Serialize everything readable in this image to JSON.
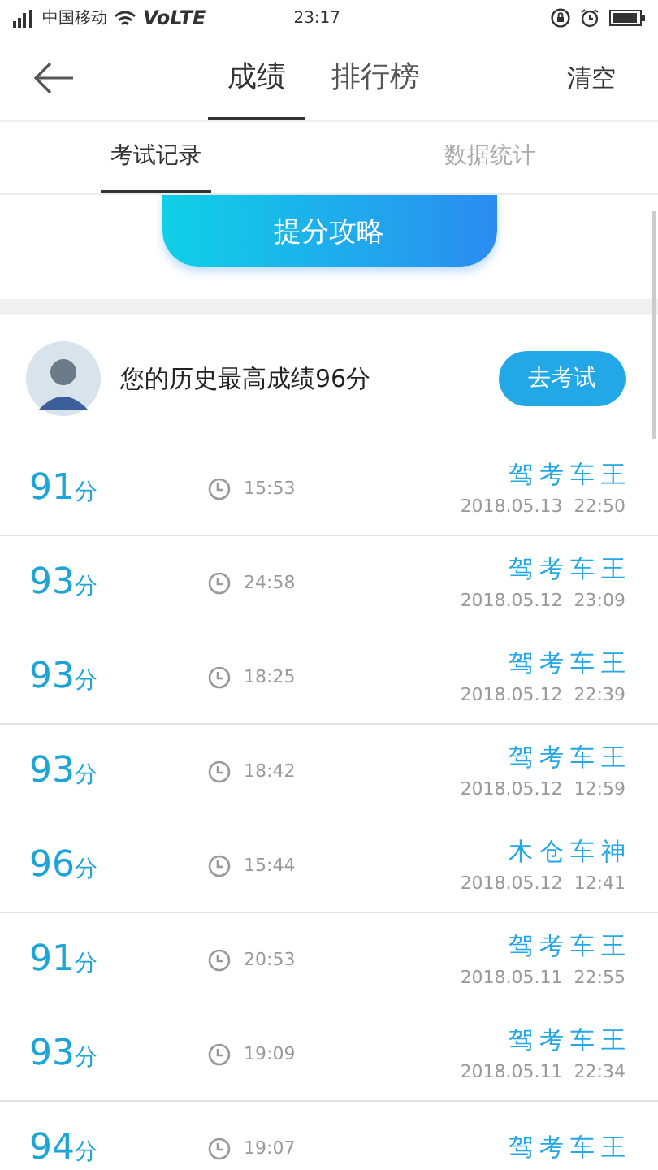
{
  "status_bar": {
    "carrier": "中国移动",
    "network": "VoLTE",
    "time": "23:17"
  },
  "header": {
    "tabs": [
      {
        "label": "成绩",
        "selected": true
      },
      {
        "label": "排行榜",
        "selected": false
      }
    ],
    "action": "清空"
  },
  "sub_tabs": [
    {
      "label": "考试记录",
      "selected": true
    },
    {
      "label": "数据统计",
      "selected": false
    }
  ],
  "tip_button": "提分攻略",
  "best": {
    "text": "您的历史最高成绩96分",
    "button": "去考试"
  },
  "records": [
    {
      "score": "91",
      "unit": "分",
      "duration": "15:53",
      "title": "驾考车王",
      "date": "2018.05.13  22:50",
      "divider_below": true
    },
    {
      "score": "93",
      "unit": "分",
      "duration": "24:58",
      "title": "驾考车王",
      "date": "2018.05.12  23:09",
      "divider_below": false
    },
    {
      "score": "93",
      "unit": "分",
      "duration": "18:25",
      "title": "驾考车王",
      "date": "2018.05.12  22:39",
      "divider_below": true
    },
    {
      "score": "93",
      "unit": "分",
      "duration": "18:42",
      "title": "驾考车王",
      "date": "2018.05.12  12:59",
      "divider_below": false
    },
    {
      "score": "96",
      "unit": "分",
      "duration": "15:44",
      "title": "木仓车神",
      "date": "2018.05.12  12:41",
      "divider_below": true
    },
    {
      "score": "91",
      "unit": "分",
      "duration": "20:53",
      "title": "驾考车王",
      "date": "2018.05.11  22:55",
      "divider_below": false
    },
    {
      "score": "93",
      "unit": "分",
      "duration": "19:09",
      "title": "驾考车王",
      "date": "2018.05.11  22:34",
      "divider_below": true
    },
    {
      "score": "94",
      "unit": "分",
      "duration": "19:07",
      "title": "驾考车王"
    }
  ]
}
